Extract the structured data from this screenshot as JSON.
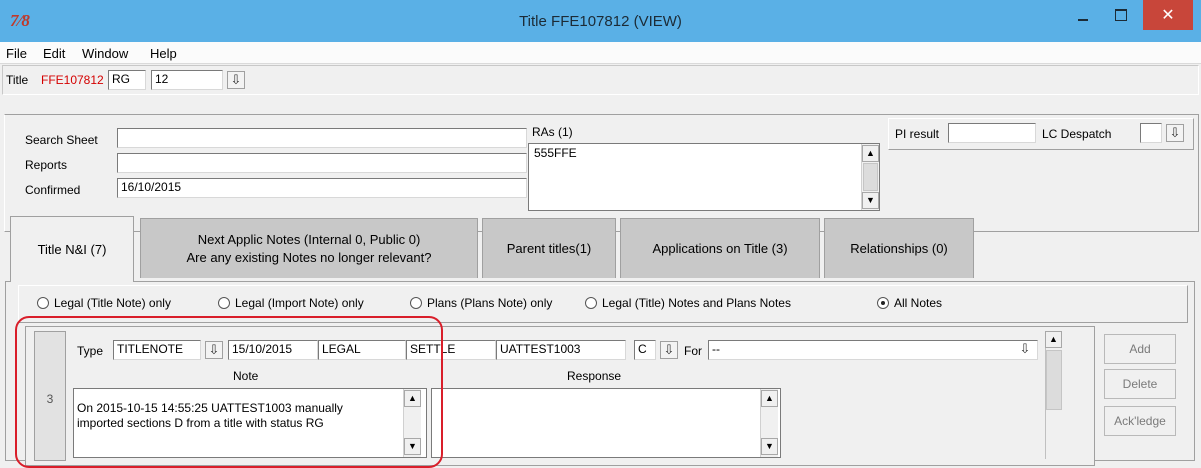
{
  "window": {
    "icon_glyph": "7⁄8",
    "title": "Title FFE107812 (VIEW)",
    "close_glyph": "✕"
  },
  "menu": [
    "File",
    "Edit",
    "Window",
    "Help"
  ],
  "title_row": {
    "label": "Title",
    "title_id": "FFE107812",
    "status": "RG",
    "number": "12",
    "dropdown_glyph": "⇩"
  },
  "header": {
    "search_sheet_label": "Search Sheet",
    "search_sheet_value": "",
    "reports_label": "Reports",
    "reports_value": "",
    "confirmed_label": "Confirmed",
    "confirmed_value": "16/10/2015",
    "ras_label": "RAs (1)",
    "ras_items": [
      "555FFE"
    ],
    "pi_result_label": "PI result",
    "pi_result_value": "",
    "lc_despatch_label": "LC Despatch",
    "lc_despatch_value": ""
  },
  "tabs": [
    {
      "label": "Title N&I (7)",
      "active": true
    },
    {
      "label_line1": "Next Applic Notes (Internal 0, Public 0)",
      "label_line2": "Are any existing Notes no longer relevant?"
    },
    {
      "label": "Parent titles(1)"
    },
    {
      "label": "Applications on Title (3)"
    },
    {
      "label": "Relationships (0)"
    }
  ],
  "filters": {
    "options": [
      "Legal (Title Note) only",
      "Legal (Import Note) only",
      "Plans (Plans Note) only",
      "Legal (Title) Notes and Plans Notes",
      "All Notes"
    ],
    "selected": "All Notes"
  },
  "note": {
    "row_number": "3",
    "type_label": "Type",
    "type_value": "TITLENOTE",
    "date": "15/10/2015",
    "category": "LEGAL",
    "action": "SETTLE",
    "user": "UATTEST1003",
    "code": "C",
    "for_label": "For",
    "for_value": "--",
    "note_header": "Note",
    "response_header": "Response",
    "note_text_line1": "On 2015-10-15 14:55:25 UATTEST1003 manually",
    "note_text_line2": "imported sections D from a title with status RG",
    "response_text": ""
  },
  "buttons": {
    "add": "Add",
    "delete": "Delete",
    "acknowledge": "Ack'ledge"
  },
  "colors": {
    "titlebar": "#5ab0e6",
    "close_button": "#c8463a",
    "title_id": "#d40000",
    "highlight": "#d91e2a"
  }
}
